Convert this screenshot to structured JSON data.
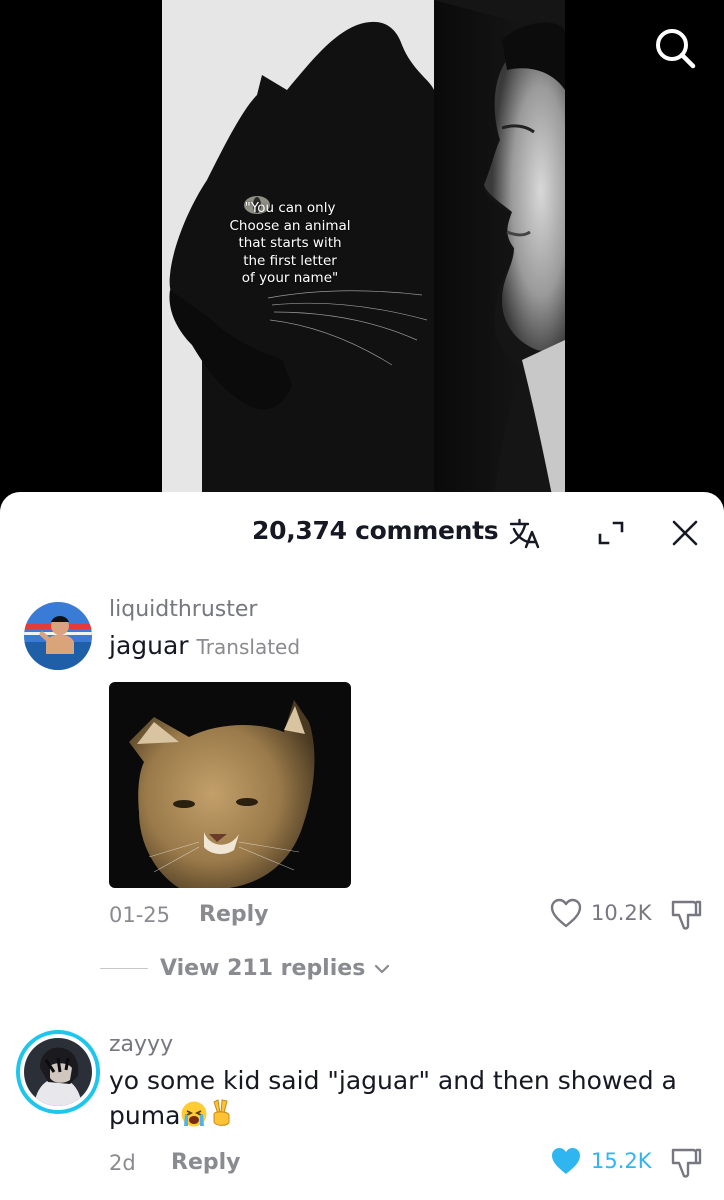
{
  "video": {
    "overlay_text": "\"You can only\nChoose an animal\nthat starts with\nthe first letter\nof your name\""
  },
  "top_bar": {
    "search_icon": "search-icon"
  },
  "sheet": {
    "comment_count": "20,374 comments",
    "icons": [
      "translate-icon",
      "expand-icon",
      "close-icon"
    ]
  },
  "comments": [
    {
      "username": "liquidthruster",
      "text": "jaguar",
      "translated_label": "Translated",
      "date": "01-25",
      "reply_label": "Reply",
      "likes": "10.2K",
      "liked": false,
      "view_replies": "View 211 replies"
    },
    {
      "username": "zayyy",
      "text": "yo some kid said \"jaguar\" and then showed a puma",
      "emojis": [
        "loudly-crying-face",
        "victory-hand"
      ],
      "date": "2d",
      "reply_label": "Reply",
      "likes": "15.2K",
      "liked": true
    }
  ],
  "colors": {
    "accent_ring": "#1ec6ee",
    "liked_heart": "#2fb6f0",
    "muted_text": "#8a8b91"
  }
}
